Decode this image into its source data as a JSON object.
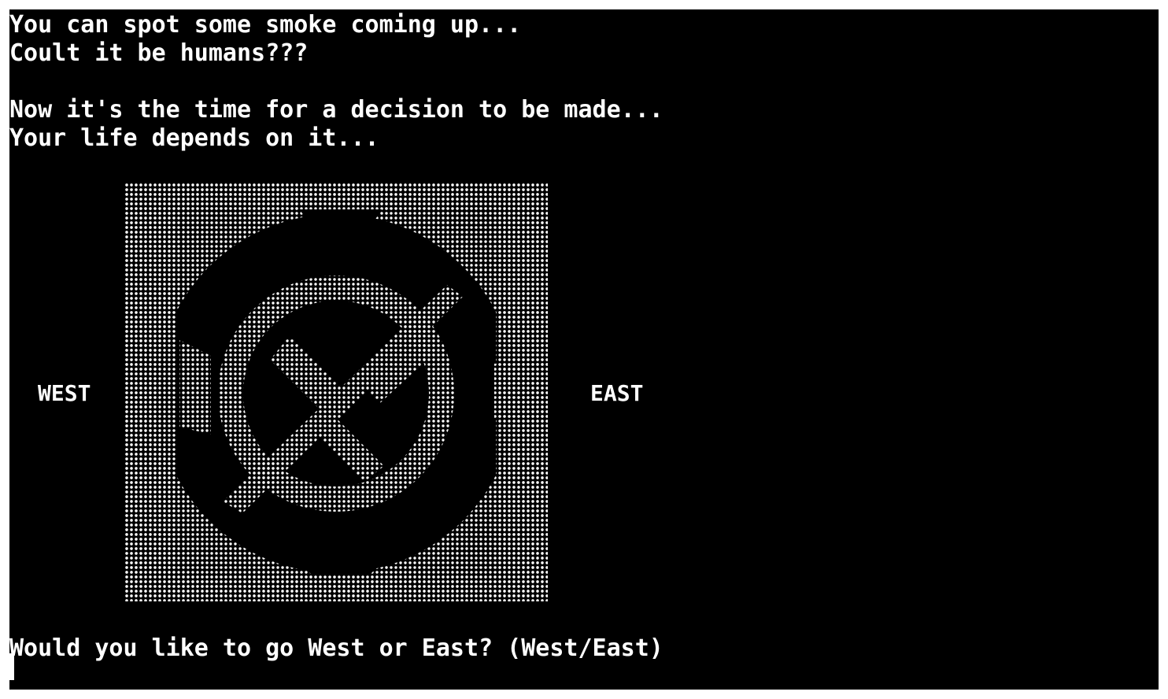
{
  "terminal": {
    "lines": [
      "You can spot some smoke coming up...",
      "Coult it be humans???",
      "Now it's the time for a decision to be made...",
      "Your life depends on it..."
    ],
    "west_label": "WEST",
    "east_label": "EAST",
    "prompt": "Would you like to go West or East? (West/East)"
  },
  "colors": {
    "background": "#000000",
    "foreground": "#ffffff",
    "page": "#ffffff"
  },
  "icons": {
    "compass_art": "compass-ascii-art-icon",
    "cursor": "block-cursor"
  }
}
